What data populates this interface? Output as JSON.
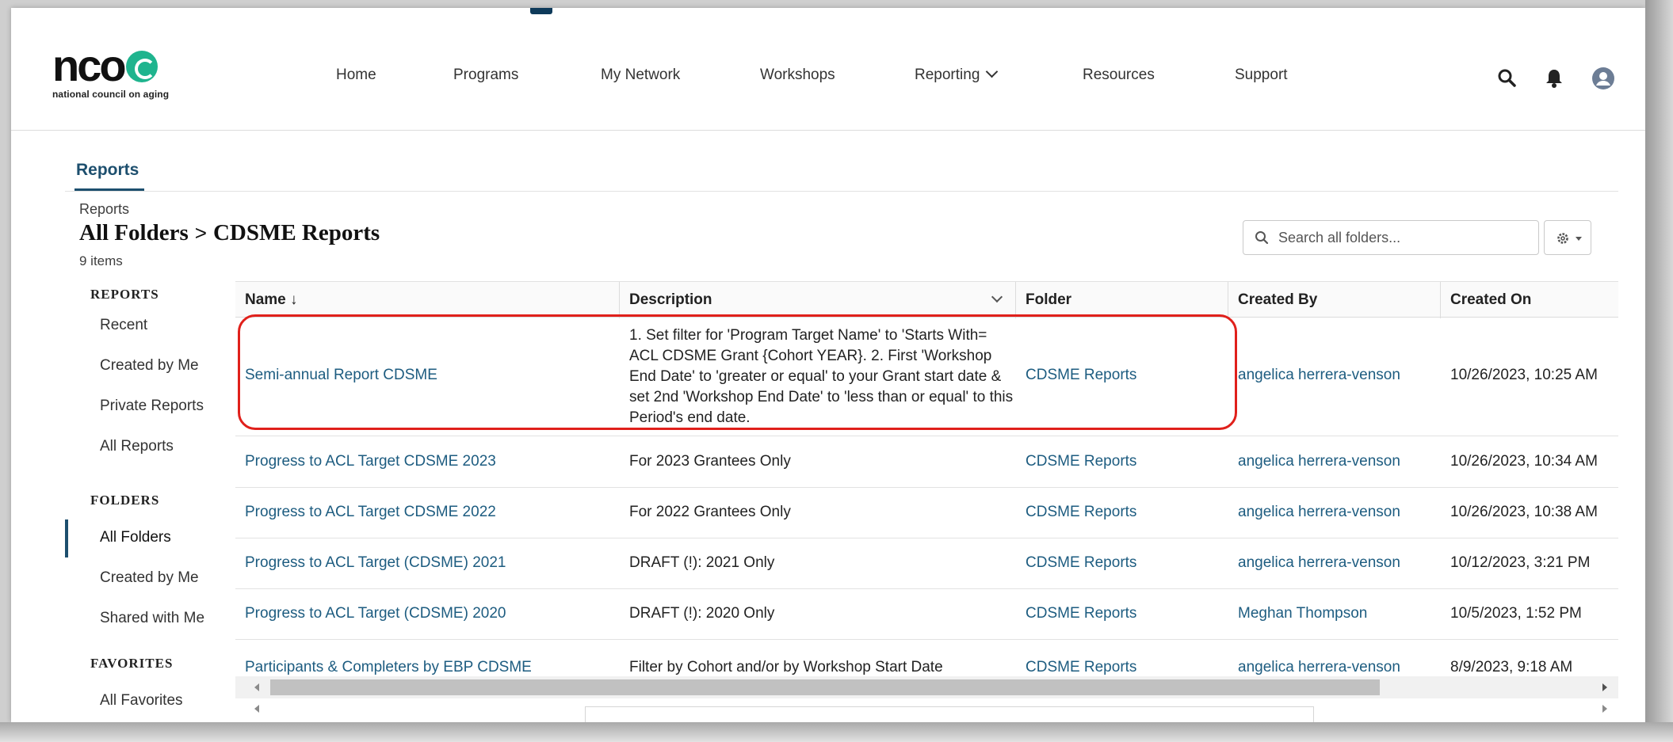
{
  "brand": {
    "wordmark": "nco",
    "tagline": "national council on aging",
    "accent": "#1fb48e"
  },
  "nav": {
    "items": [
      "Home",
      "Programs",
      "My Network",
      "Workshops",
      "Reporting",
      "Resources",
      "Support"
    ]
  },
  "header_icons": [
    "search-icon",
    "bell-icon",
    "user-avatar-icon"
  ],
  "tab": {
    "label": "Reports"
  },
  "breadcrumb": {
    "small": "Reports",
    "parent": "All Folders",
    "separator": ">",
    "current": "CDSME Reports",
    "count": "9 items"
  },
  "search": {
    "placeholder": "Search all folders..."
  },
  "sidebar": {
    "reports_head": "REPORTS",
    "reports_items": [
      "Recent",
      "Created by Me",
      "Private Reports",
      "All Reports"
    ],
    "folders_head": "FOLDERS",
    "folders_items": [
      "All Folders",
      "Created by Me",
      "Shared with Me"
    ],
    "favorites_head": "FAVORITES",
    "favorites_items": [
      "All Favorites"
    ]
  },
  "table": {
    "columns": [
      "Name ↓",
      "Description",
      "Folder",
      "Created By",
      "Created On"
    ],
    "rows": [
      {
        "name": "Semi-annual Report CDSME",
        "description": "1. Set filter for 'Program Target Name' to 'Starts With= ACL CDSME Grant {Cohort YEAR}. 2. First 'Workshop End Date' to 'greater or equal' to your Grant start date & set 2nd 'Workshop End Date' to 'less than or equal' to this Period's end date.",
        "folder": "CDSME Reports",
        "created_by": "angelica herrera-venson",
        "created_on": "10/26/2023, 10:25 AM"
      },
      {
        "name": "Progress to ACL Target CDSME 2023",
        "description": "For 2023 Grantees Only",
        "folder": "CDSME Reports",
        "created_by": "angelica herrera-venson",
        "created_on": "10/26/2023, 10:34 AM"
      },
      {
        "name": "Progress to ACL Target CDSME 2022",
        "description": "For 2022 Grantees Only",
        "folder": "CDSME Reports",
        "created_by": "angelica herrera-venson",
        "created_on": "10/26/2023, 10:38 AM"
      },
      {
        "name": "Progress to ACL Target (CDSME) 2021",
        "description": "DRAFT (!): 2021 Only",
        "folder": "CDSME Reports",
        "created_by": "angelica herrera-venson",
        "created_on": "10/12/2023, 3:21 PM"
      },
      {
        "name": "Progress to ACL Target (CDSME) 2020",
        "description": "DRAFT (!): 2020 Only",
        "folder": "CDSME Reports",
        "created_by": "Meghan Thompson",
        "created_on": "10/5/2023, 1:52 PM"
      },
      {
        "name": "Participants & Completers by EBP CDSME",
        "description": "Filter by Cohort and/or by Workshop Start Date",
        "folder": "CDSME Reports",
        "created_by": "angelica herrera-venson",
        "created_on": "8/9/2023, 9:18 AM"
      }
    ]
  },
  "colors": {
    "link": "#1d5c80",
    "highlight": "#e0201b",
    "active": "#1d4f6e"
  }
}
